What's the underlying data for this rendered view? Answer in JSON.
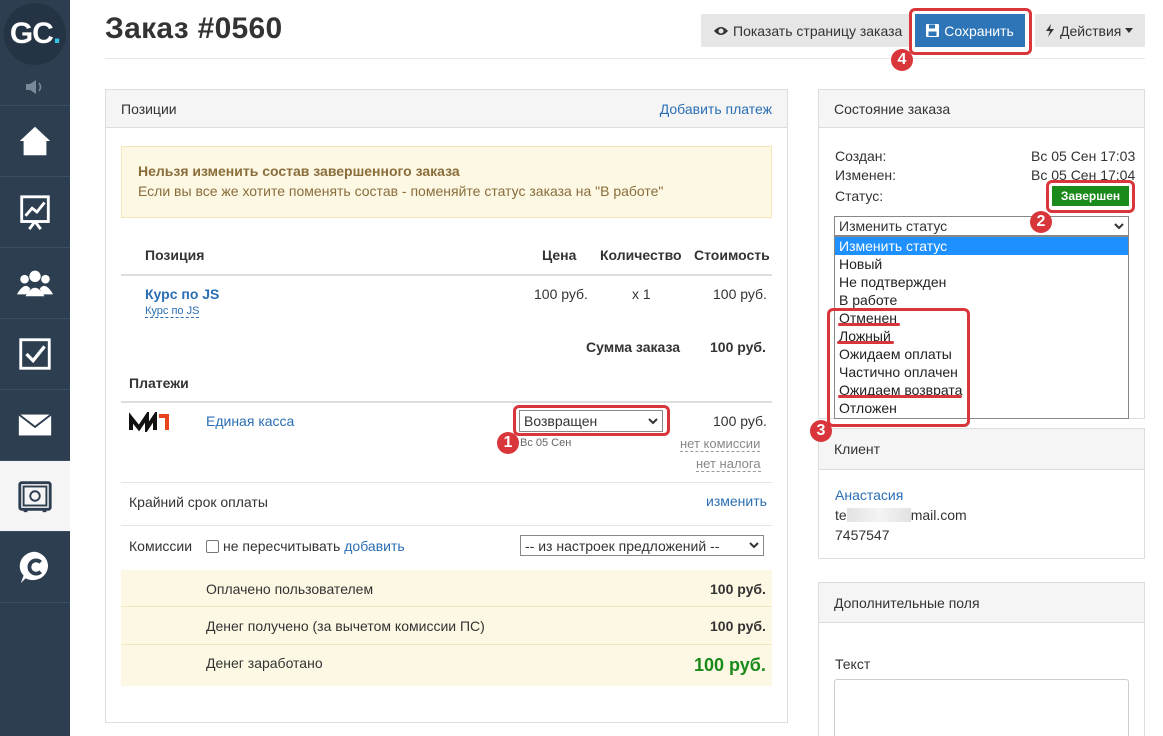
{
  "sidebar": {
    "logo_g": "GC",
    "logo_dot": "."
  },
  "header": {
    "title": "Заказ #0560",
    "show_page_label": "Показать страницу заказа",
    "save_label": "Сохранить",
    "actions_label": "Действия"
  },
  "positions": {
    "title": "Позиции",
    "add_payment": "Добавить платеж",
    "warning_title": "Нельзя изменить состав завершенного заказа",
    "warning_text": "Если вы все же хотите поменять состав - поменяйте статус заказа на \"В работе\"",
    "columns": {
      "position": "Позиция",
      "price": "Цена",
      "quantity": "Количество",
      "cost": "Стоимость"
    },
    "item": {
      "name": "Курс по JS",
      "sub": "Курс по JS",
      "price": "100 руб.",
      "quantity": "x 1",
      "cost": "100 руб."
    },
    "sum_label": "Сумма заказа",
    "sum_value": "100 руб.",
    "payments_title": "Платежи",
    "payment": {
      "provider": "Единая касса",
      "status": "Возвращен",
      "date": "Вс 05 Сен",
      "amount": "100 руб.",
      "no_commission": "нет комиссии",
      "no_tax": "нет налога"
    },
    "deadline_label": "Крайний срок оплаты",
    "deadline_change": "изменить",
    "commissions_label": "Комиссии",
    "no_recalc": "не пересчитывать",
    "add_link": "добавить",
    "commission_select": "-- из настроек предложений --",
    "totals": [
      {
        "label": "Оплачено пользователем",
        "value": "100 руб."
      },
      {
        "label": "Денег получено (за вычетом комиссии ПС)",
        "value": "100 руб."
      },
      {
        "label": "Денег заработано",
        "value": "100 руб."
      }
    ]
  },
  "state": {
    "title": "Состояние заказа",
    "created_label": "Создан:",
    "created_value": "Вс 05 Сен 17:03",
    "changed_label": "Изменен:",
    "changed_value": "Вс 05 Сен 17:04",
    "status_label": "Статус:",
    "status_badge": "Завершен",
    "change_status": "Изменить статус",
    "options": [
      "Изменить статус",
      "Новый",
      "Не подтвержден",
      "В работе",
      "Отменен",
      "Ложный",
      "Ожидаем оплаты",
      "Частично оплачен",
      "Ожидаем возврата",
      "Отложен"
    ]
  },
  "client": {
    "title": "Клиент",
    "name": "Анастасия",
    "email_prefix": "te",
    "email_suffix": "mail.com",
    "phone": "7457547"
  },
  "extra": {
    "title": "Дополнительные поля",
    "text_label": "Текст"
  },
  "annotations": [
    "1",
    "2",
    "3",
    "4"
  ],
  "colors": {
    "sidebar": "#2d3e50",
    "accent": "#2e75b8",
    "annotation": "#d8363a",
    "status_green": "#1a8a1a",
    "earned_green": "#1a8a1a"
  }
}
